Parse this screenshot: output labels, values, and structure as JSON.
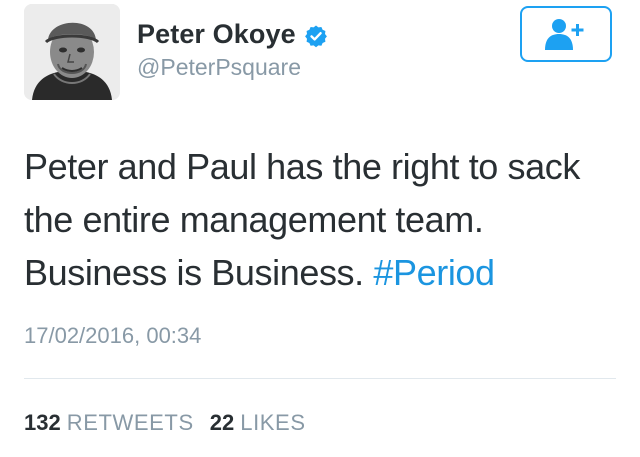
{
  "profile": {
    "display_name": "Peter Okoye",
    "handle": "@PeterPsquare",
    "verified_icon": "verified-badge-icon",
    "follow_icon": "add-user-icon"
  },
  "tweet": {
    "text": "Peter and Paul has the right to sack the entire management team. Business is Business.",
    "hashtag": "#Period",
    "timestamp": "17/02/2016, 00:34"
  },
  "stats": {
    "retweets_count": "132",
    "retweets_label": "RETWEETS",
    "likes_count": "22",
    "likes_label": "LIKES"
  },
  "colors": {
    "accent": "#1da1f2",
    "hashtag": "#1b95e0",
    "text": "#292f33",
    "muted": "#8899a6",
    "divider": "#e1e8ed"
  }
}
